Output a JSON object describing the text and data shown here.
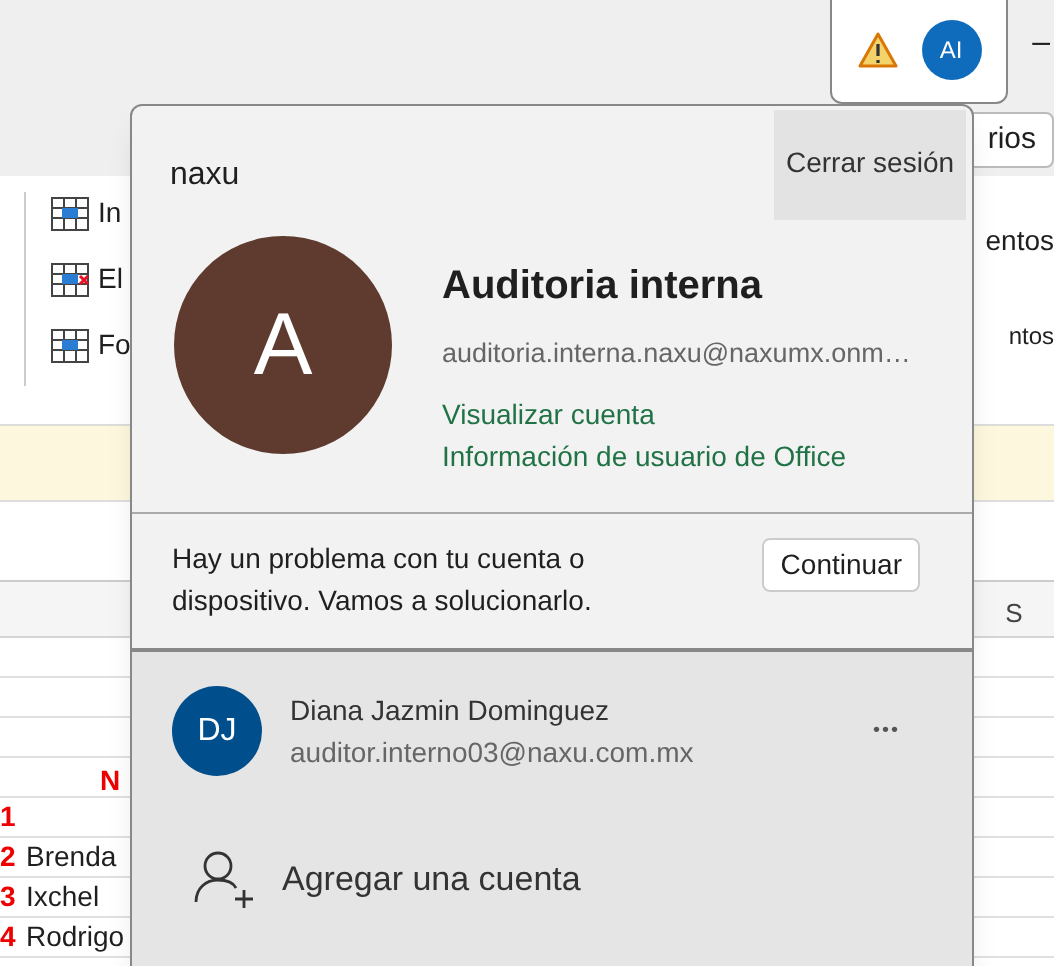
{
  "title_bar": {
    "account_initials": "AI",
    "minimize": "–"
  },
  "ribbon": {
    "left_items": [
      "In",
      "El",
      "Fo"
    ],
    "right_button": "rios",
    "right_labels": [
      "entos",
      "ntos"
    ]
  },
  "sheet": {
    "column_header": "S",
    "header_cell": "N",
    "rows": [
      {
        "number": "1"
      },
      {
        "number": "2",
        "name": "Brenda"
      },
      {
        "number": "3",
        "name": "Ixchel"
      },
      {
        "number": "4",
        "name": "Rodrigo"
      }
    ]
  },
  "account_menu": {
    "org": "naxu",
    "sign_out": "Cerrar sesión",
    "avatar_initial": "A",
    "name": "Auditoria interna",
    "email": "auditoria.interna.naxu@naxumx.onm…",
    "links": [
      "Visualizar cuenta",
      "Información de usuario de Office"
    ],
    "notice": {
      "text": "Hay un problema con tu cuenta o dispositivo. Vamos a solucionarlo.",
      "button": "Continuar"
    },
    "other_accounts": [
      {
        "initials": "DJ",
        "name": "Diana Jazmin Dominguez",
        "email": "auditor.interno03@naxu.com.mx",
        "more": "•••"
      }
    ],
    "add_account": "Agregar una cuenta"
  }
}
